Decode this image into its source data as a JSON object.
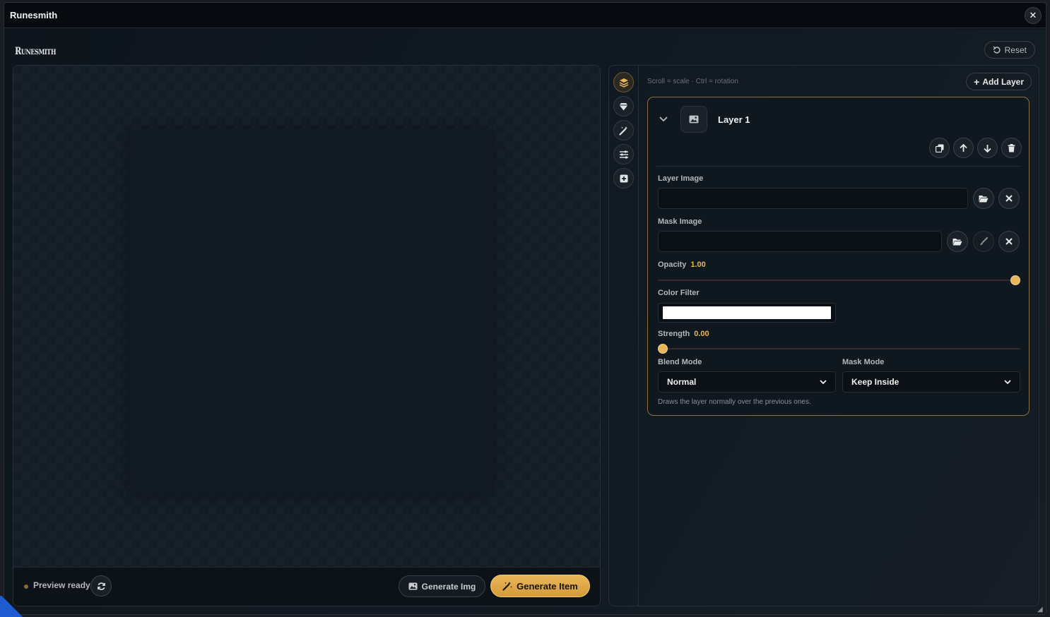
{
  "window": {
    "title": "Runesmith",
    "close_glyph": "✕"
  },
  "header": {
    "brand": "Runesmith",
    "reset_label": "Reset"
  },
  "preview": {
    "status": "Preview ready",
    "generate_img_label": "Generate Img",
    "generate_item_label": "Generate Item"
  },
  "rail": {
    "items": [
      {
        "name": "layers-icon",
        "active": true
      },
      {
        "name": "gem-icon",
        "active": false
      },
      {
        "name": "magic-wand-icon",
        "active": false
      },
      {
        "name": "sliders-icon",
        "active": false
      },
      {
        "name": "add-box-icon",
        "active": false
      }
    ]
  },
  "editor": {
    "hint": "Scroll = scale · Ctrl = rotation",
    "add_layer_label": "Add Layer",
    "layer": {
      "name": "Layer 1",
      "layer_image_label": "Layer Image",
      "layer_image_value": "",
      "mask_image_label": "Mask Image",
      "mask_image_value": "",
      "opacity_label": "Opacity",
      "opacity_value": "1.00",
      "opacity_fraction": 1.0,
      "color_filter_label": "Color Filter",
      "color_filter_value": "#ffffff",
      "strength_label": "Strength",
      "strength_value": "0.00",
      "strength_fraction": 0.0,
      "blend_mode_label": "Blend Mode",
      "blend_mode_value": "Normal",
      "mask_mode_label": "Mask Mode",
      "mask_mode_value": "Keep Inside",
      "description": "Draws the layer normally over the previous ones."
    }
  },
  "colors": {
    "accent": "#e8b65a",
    "card_border": "#8a7342",
    "background": "#0f161d"
  }
}
